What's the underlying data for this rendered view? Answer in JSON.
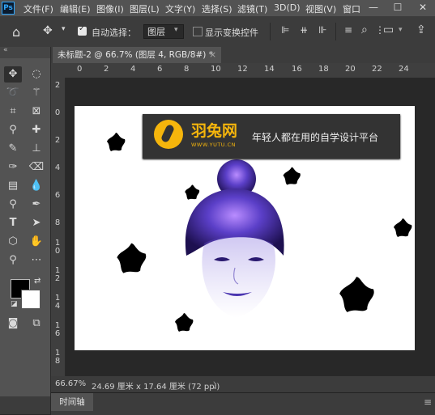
{
  "app": {
    "logo": "Ps"
  },
  "menubar": {
    "items": [
      "文件(F)",
      "编辑(E)",
      "图像(I)",
      "图层(L)",
      "文字(Y)",
      "选择(S)",
      "滤镜(T)",
      "3D(D)",
      "视图(V)",
      "窗口"
    ],
    "window_buttons": [
      "—",
      "☐",
      "✕"
    ]
  },
  "options_bar": {
    "auto_select_label": "自动选择：",
    "auto_select_target": "图层",
    "show_transform_label": "显示变换控件"
  },
  "document": {
    "tab_title": "未标题-2 @ 66.7% (图层 4, RGB/8#) *",
    "tab_close": "×"
  },
  "ruler_top": [
    "0",
    "2",
    "4",
    "6",
    "8",
    "10",
    "12",
    "14",
    "16",
    "18",
    "20",
    "22",
    "24"
  ],
  "ruler_left": [
    "2",
    "0",
    "2",
    "4",
    "6",
    "8",
    "1\n0",
    "1\n2",
    "1\n4",
    "1\n6",
    "1\n8"
  ],
  "canvas": {
    "brand_name": "羽兔网",
    "brand_url": "WWW.YUTU.CN",
    "slogan": "年轻人都在用的自学设计平台"
  },
  "status": {
    "zoom": "66.67%",
    "doc_size": "24.69 厘米 x 17.64 厘米 (72 ppi)",
    "arrow": "〉"
  },
  "panels": {
    "timeline_tab": "时间轴"
  },
  "colors": {
    "foreground": "#000000",
    "background": "#ffffff",
    "accent": "#f5b50c"
  }
}
